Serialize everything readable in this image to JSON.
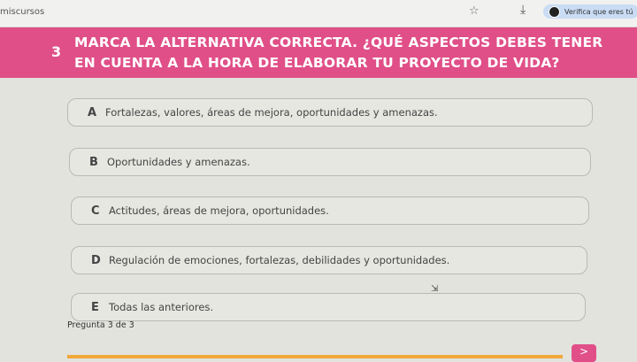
{
  "browser": {
    "url_fragment": "miscursos",
    "star_icon": "star-icon",
    "download_icon": "download-icon",
    "extension_label": "Verifica que eres tú"
  },
  "question": {
    "number": "3",
    "text": "MARCA LA ALTERNATIVA CORRECTA. ¿QUÉ ASPECTOS DEBES TENER EN CUENTA A LA HORA DE ELABORAR TU PROYECTO DE VIDA?"
  },
  "options": [
    {
      "letter": "A",
      "text": "Fortalezas, valores, áreas de mejora, oportunidades y amenazas."
    },
    {
      "letter": "B",
      "text": "Oportunidades y amenazas."
    },
    {
      "letter": "C",
      "text": "Actitudes, áreas de mejora, oportunidades."
    },
    {
      "letter": "D",
      "text": "Regulación de emociones, fortalezas, debilidades y oportunidades."
    },
    {
      "letter": "E",
      "text": "Todas las anteriores."
    }
  ],
  "footer": {
    "progress_label": "Pregunta 3 de 3",
    "progress_fraction": 1.0,
    "next_label": ">"
  },
  "colors": {
    "accent": "#e04f88",
    "progress": "#f0a83a"
  }
}
